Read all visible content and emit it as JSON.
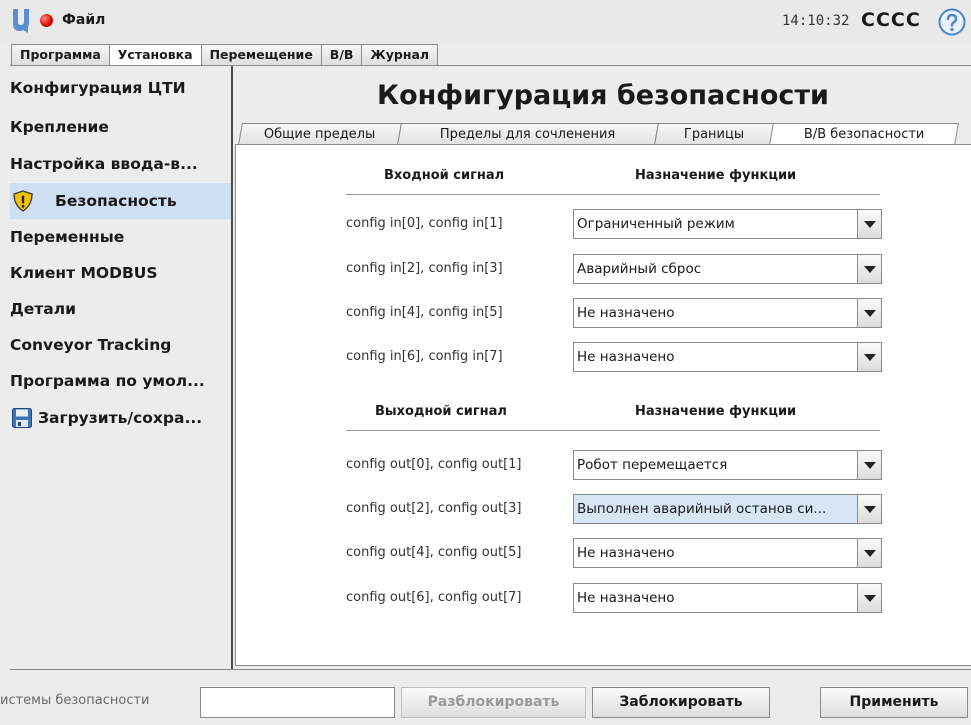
{
  "header": {
    "file_menu": "Файл",
    "time": "14:10:32",
    "robot_name": "CCCC"
  },
  "main_tabs": [
    {
      "label": "Программа"
    },
    {
      "label": "Установка"
    },
    {
      "label": "Перемещение"
    },
    {
      "label": "В/В"
    },
    {
      "label": "Журнал"
    }
  ],
  "sidebar": {
    "items": [
      {
        "label": "Конфигурация ЦТИ"
      },
      {
        "label": "Крепление"
      },
      {
        "label": "Настройка ввода-в..."
      },
      {
        "label": "Безопасность",
        "icon": "warning-shield-icon"
      },
      {
        "label": "Переменные"
      },
      {
        "label": "Клиент MODBUS"
      },
      {
        "label": "Детали"
      },
      {
        "label": "Conveyor Tracking"
      },
      {
        "label": "Программа по умол..."
      },
      {
        "label": "Загрузить/сохра...",
        "icon": "save-disk-icon"
      }
    ]
  },
  "page": {
    "title": "Конфигурация безопасности",
    "tabs": [
      {
        "label": "Общие пределы"
      },
      {
        "label": "Пределы для сочленения"
      },
      {
        "label": "Границы"
      },
      {
        "label": "В/В безопасности"
      }
    ]
  },
  "inputs": {
    "header_signal": "Входной сигнал",
    "header_function": "Назначение функции",
    "rows": [
      {
        "signal": "config in[0], config in[1]",
        "function": "Ограниченный режим"
      },
      {
        "signal": "config in[2], config in[3]",
        "function": "Аварийный сброс"
      },
      {
        "signal": "config in[4], config in[5]",
        "function": "Не назначено"
      },
      {
        "signal": "config in[6], config in[7]",
        "function": "Не назначено"
      }
    ]
  },
  "outputs": {
    "header_signal": "Выходной сигнал",
    "header_function": "Назначение функции",
    "rows": [
      {
        "signal": "config out[0], config out[1]",
        "function": "Робот перемещается"
      },
      {
        "signal": "config out[2], config out[3]",
        "function": "Выполнен аварийный останов си..."
      },
      {
        "signal": "config out[4], config out[5]",
        "function": "Не назначено"
      },
      {
        "signal": "config out[6], config out[7]",
        "function": "Не назначено"
      }
    ]
  },
  "footer": {
    "password_label": "истемы безопасности",
    "unlock": "Разблокировать",
    "lock": "Заблокировать",
    "apply": "Применить"
  },
  "colors": {
    "selection": "#cfe0f3",
    "highlight_combo": "#d7e6f5",
    "status_dot": "#d50000",
    "help": "#4a86c8"
  }
}
